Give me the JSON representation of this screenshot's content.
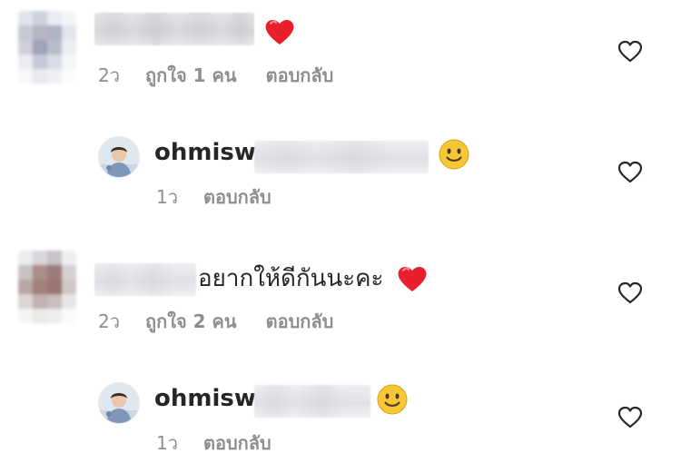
{
  "comments": [
    {
      "time": "2ว",
      "likes": "ถูกใจ 1 คน",
      "reply": "ตอบกลับ",
      "emoji": "red-heart",
      "text": ""
    },
    {
      "username": "ohmisw",
      "time": "1ว",
      "reply": "ตอบกลับ",
      "emoji": "slightly-smiling-face"
    },
    {
      "text": "อยากให้ดีกันนะคะ",
      "time": "2ว",
      "likes": "ถูกใจ 2 คน",
      "reply": "ตอบกลับ",
      "emoji": "red-heart"
    },
    {
      "username": "ohmisw",
      "time": "1ว",
      "reply": "ตอบกลับ",
      "emoji": "slightly-smiling-face"
    }
  ],
  "colors": {
    "heart": "#e8202d",
    "smiley": "#f5c635",
    "meta_text": "#8e8e8e",
    "primary_text": "#262626"
  }
}
